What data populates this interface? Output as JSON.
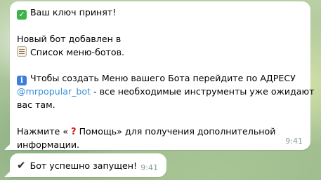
{
  "messages": [
    {
      "lines": {
        "l1": "Ваш ключ принят!",
        "l2": "Новый бот добавлен в",
        "l3": "Список меню-ботов.",
        "l4": "Чтобы создать Меню вашего Бота перейдите по АДРЕСУ",
        "l5_mention": "@mrpopular_bot",
        "l5_rest": " - все необходимые инструменты уже ожидают",
        "l6": "вас там.",
        "l7_before": "Нажмите « ",
        "l7_after": " Помощь» для получения дополнительной",
        "l8": "информации."
      },
      "icons": {
        "check": "white-check-mark-icon",
        "clipboard": "clipboard-icon",
        "info": "information-icon",
        "question": "red-question-mark-icon"
      },
      "time": "9:41"
    },
    {
      "text": "Бот успешно запущен!",
      "icon": "heavy-check-mark-icon",
      "time": "9:41"
    }
  ],
  "colors": {
    "bubble": "#ffffff",
    "mention": "#3a8fd6",
    "timestamp": "#8c9a9f",
    "check_emoji": "#3cb44a",
    "info_emoji": "#3d7ed8",
    "question_mark": "#d11b1b"
  }
}
